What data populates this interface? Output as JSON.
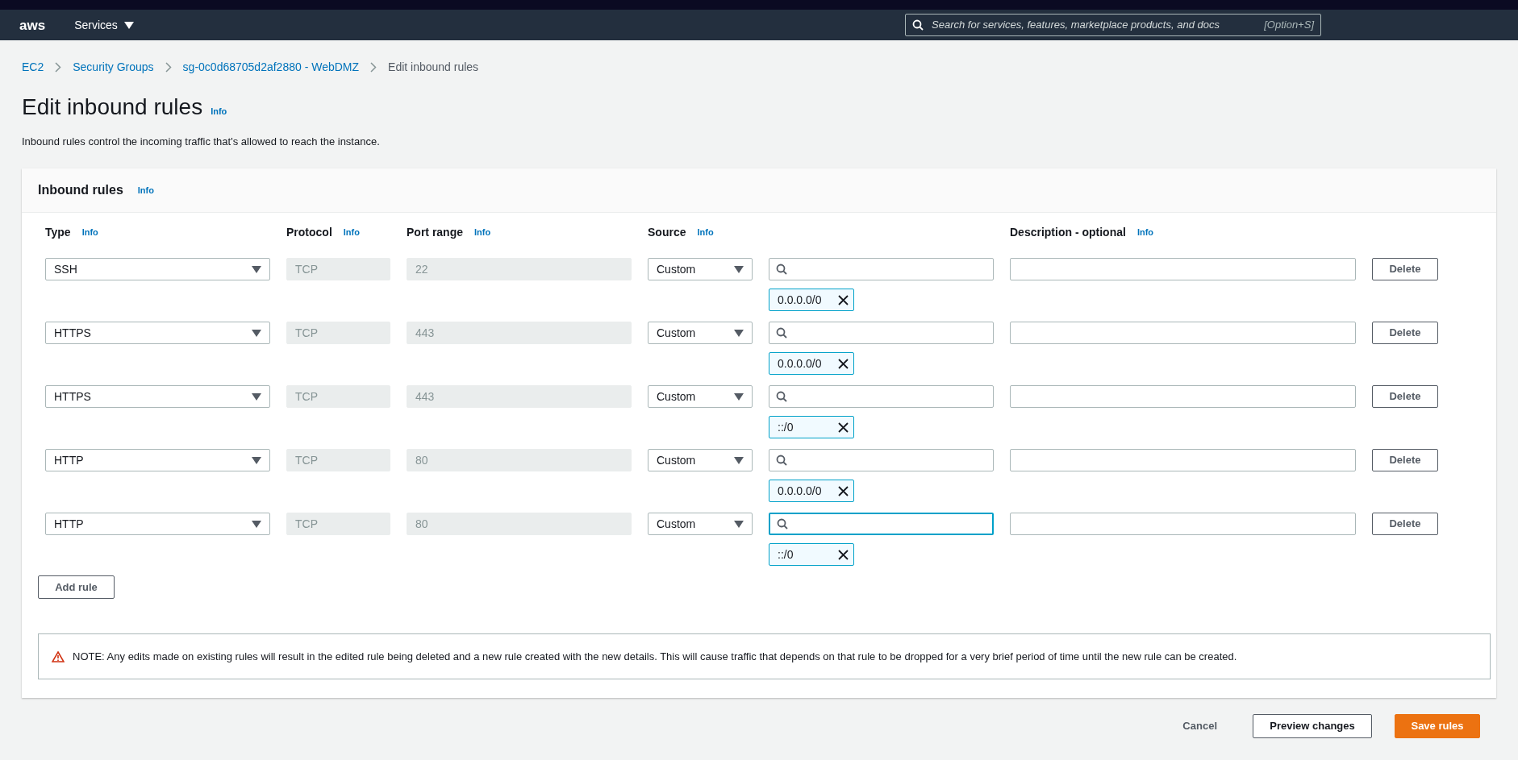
{
  "topbar": {
    "logo": "aws",
    "services": "Services",
    "search": {
      "placeholder": "Search for services, features, marketplace products, and docs",
      "shortcut": "[Option+S]"
    }
  },
  "breadcrumbs": [
    {
      "label": "EC2",
      "link": true
    },
    {
      "label": "Security Groups",
      "link": true
    },
    {
      "label": "sg-0c0d68705d2af2880 - WebDMZ",
      "link": true
    },
    {
      "label": "Edit inbound rules",
      "link": false
    }
  ],
  "page": {
    "title": "Edit inbound rules",
    "info": "Info",
    "description": "Inbound rules control the incoming traffic that's allowed to reach the instance."
  },
  "panel": {
    "title": "Inbound rules",
    "info": "Info",
    "columns": [
      {
        "label": "Type",
        "info": "Info"
      },
      {
        "label": "Protocol",
        "info": "Info"
      },
      {
        "label": "Port range",
        "info": "Info"
      },
      {
        "label": "Source",
        "info": "Info"
      },
      {
        "label": "Description - optional",
        "info": "Info"
      }
    ],
    "rows": [
      {
        "type": "SSH",
        "protocol": "TCP",
        "port": "22",
        "source": "Custom",
        "focused": false,
        "token": "0.0.0.0/0",
        "delete": "Delete"
      },
      {
        "type": "HTTPS",
        "protocol": "TCP",
        "port": "443",
        "source": "Custom",
        "focused": false,
        "token": "0.0.0.0/0",
        "delete": "Delete"
      },
      {
        "type": "HTTPS",
        "protocol": "TCP",
        "port": "443",
        "source": "Custom",
        "focused": false,
        "token": "::/0",
        "delete": "Delete"
      },
      {
        "type": "HTTP",
        "protocol": "TCP",
        "port": "80",
        "source": "Custom",
        "focused": false,
        "token": "0.0.0.0/0",
        "delete": "Delete"
      },
      {
        "type": "HTTP",
        "protocol": "TCP",
        "port": "80",
        "source": "Custom",
        "focused": true,
        "token": "::/0",
        "delete": "Delete"
      }
    ],
    "add_rule": "Add rule",
    "note": "NOTE: Any edits made on existing rules will result in the edited rule being deleted and a new rule created with the new details. This will cause traffic that depends on that rule to be dropped for a very brief period of time until the new rule can be created."
  },
  "footer": {
    "cancel": "Cancel",
    "preview": "Preview changes",
    "save": "Save rules"
  }
}
